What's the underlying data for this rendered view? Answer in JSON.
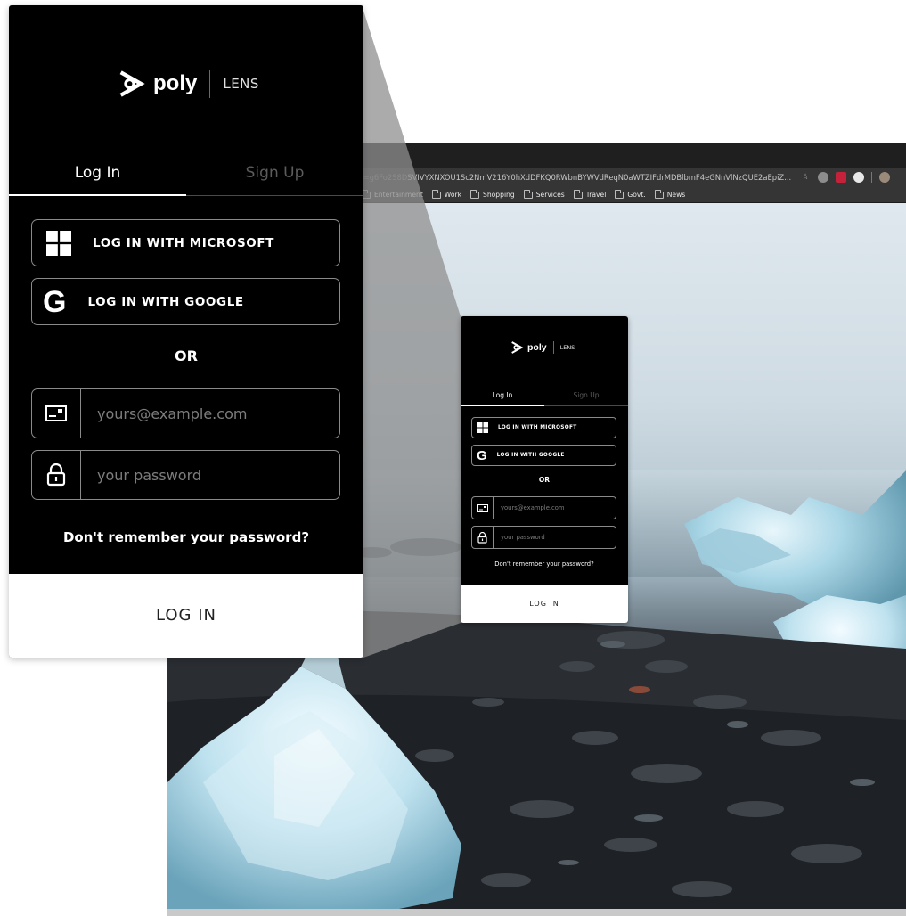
{
  "browser": {
    "url_dim": "ate=g6Fo2S8D",
    "url": "SVIVYXNXOU1Sc2NmV216Y0hXdDFKQ0RWbnBYWVdReqN0aWTZIFdrMDBlbmF4eGNnVlNzQUE2aEpiZ...",
    "bookmarks": [
      {
        "label": "Entertainment"
      },
      {
        "label": "Work"
      },
      {
        "label": "Shopping"
      },
      {
        "label": "Services"
      },
      {
        "label": "Travel"
      },
      {
        "label": "Govt."
      },
      {
        "label": "News"
      }
    ]
  },
  "login": {
    "brand": "poly",
    "product": "LENS",
    "tabs": {
      "login": "Log In",
      "signup": "Sign Up"
    },
    "microsoft_label": "LOG IN WITH MICROSOFT",
    "google_label": "LOG IN WITH GOOGLE",
    "or_label": "OR",
    "email_placeholder": "yours@example.com",
    "password_placeholder": "your password",
    "forgot_label": "Don't remember your password?",
    "submit_label": "LOG IN"
  },
  "colors": {
    "card_bg": "#000000",
    "accent": "#ffffff",
    "border": "#8a8a8a",
    "muted": "#5c5c5c"
  }
}
